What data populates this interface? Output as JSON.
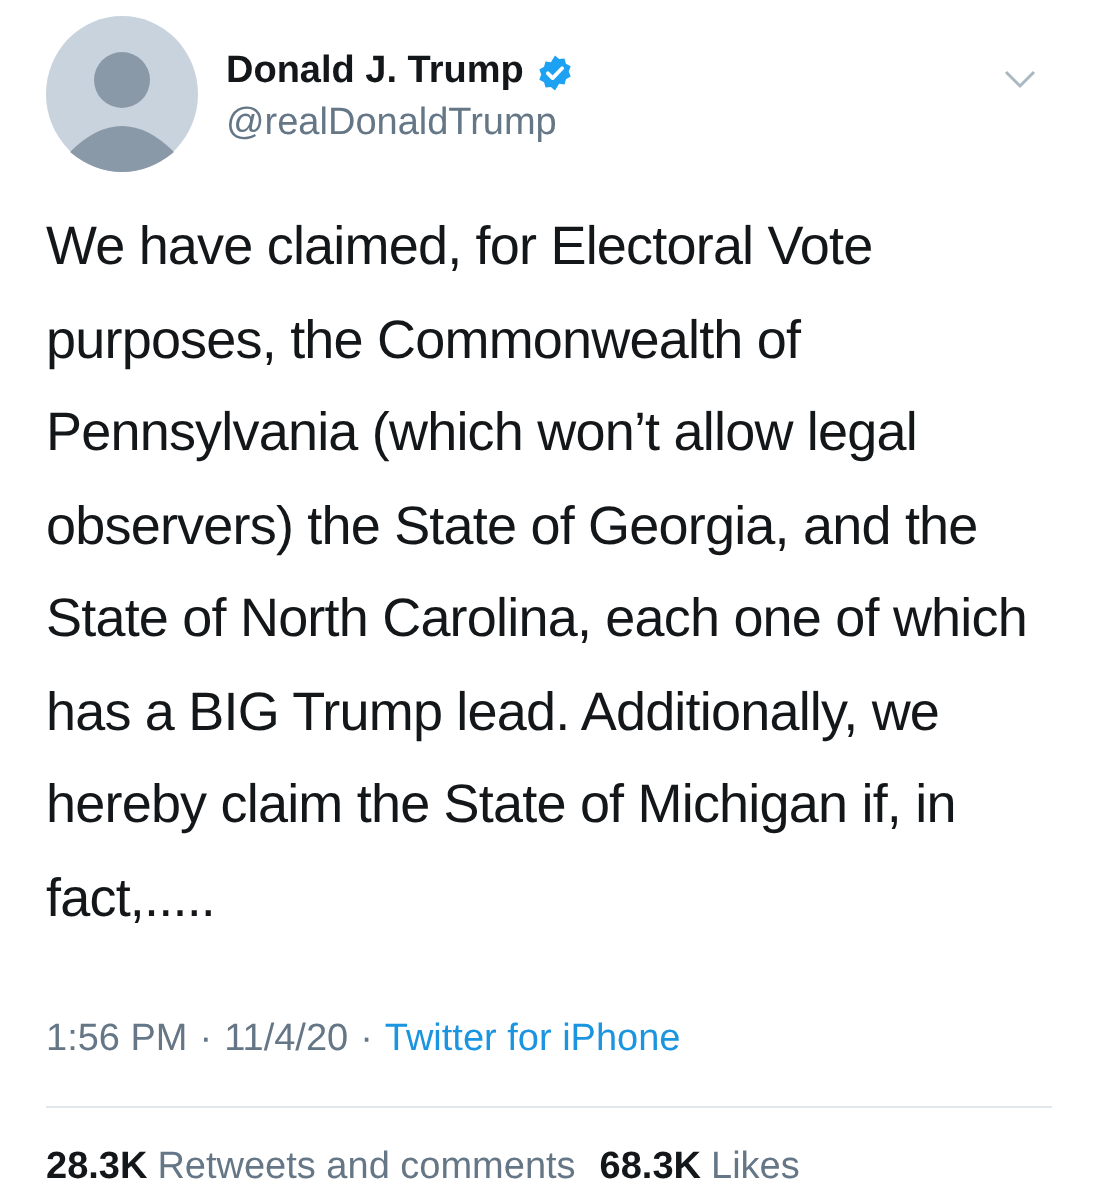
{
  "author": {
    "name": "Donald J. Trump",
    "verified": true,
    "handle": "@realDonaldTrump"
  },
  "tweet": {
    "text": "We have claimed, for Electoral Vote purposes, the Commonwealth of Pennsylvania (which won’t allow legal observers) the State of Georgia, and the State of North Carolina, each one of which has a BIG Trump lead. Additionally, we hereby claim the State of Michigan if, in fact,.....",
    "time": "1:56 PM",
    "separator_1": "·",
    "date": "11/4/20",
    "separator_2": "·",
    "source": "Twitter for iPhone"
  },
  "stats": [
    {
      "count": "28.3K",
      "label": "Retweets and comments"
    },
    {
      "count": "68.3K",
      "label": "Likes"
    }
  ]
}
